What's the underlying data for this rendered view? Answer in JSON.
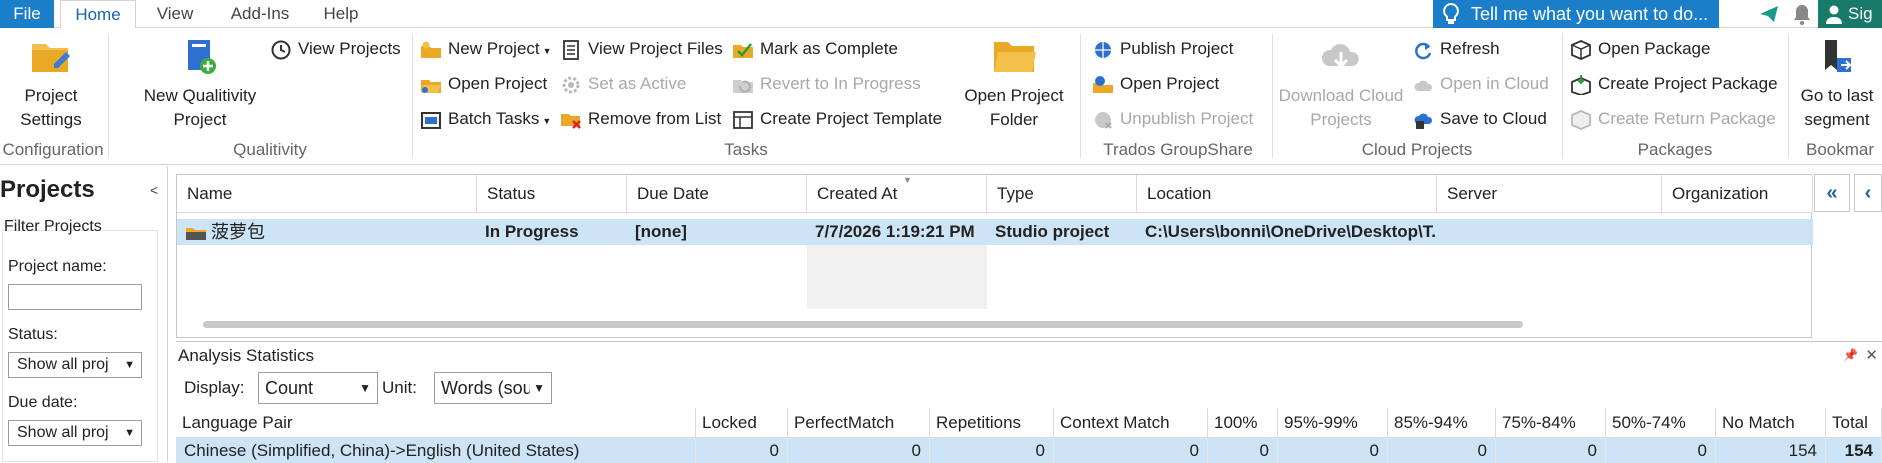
{
  "tabs": {
    "file": "File",
    "home": "Home",
    "view": "View",
    "addins": "Add-Ins",
    "help": "Help"
  },
  "tell_me": "Tell me what you want to do...",
  "sign_in": "Sig",
  "ribbon": {
    "configuration": {
      "project_settings": "Project Settings",
      "group": "Configuration"
    },
    "qualitivity": {
      "new_project": "New Qualitivity Project",
      "view_projects": "View Projects",
      "group": "Qualitivity"
    },
    "tasks": {
      "new_project": "New Project",
      "open_project": "Open Project",
      "batch_tasks": "Batch Tasks",
      "view_project_files": "View Project Files",
      "set_as_active": "Set as Active",
      "remove_from_list": "Remove from List",
      "mark_as_complete": "Mark as Complete",
      "revert_to_in_progress": "Revert to In Progress",
      "create_project_template": "Create Project Template",
      "open_project_folder": "Open Project Folder",
      "group": "Tasks"
    },
    "groupshare": {
      "publish_project": "Publish Project",
      "open_project": "Open Project",
      "unpublish_project": "Unpublish Project",
      "group": "Trados GroupShare"
    },
    "cloud": {
      "download_cloud_projects": "Download Cloud Projects",
      "refresh": "Refresh",
      "open_in_cloud": "Open in Cloud",
      "save_to_cloud": "Save to Cloud",
      "group": "Cloud Projects"
    },
    "packages": {
      "open_package": "Open Package",
      "create_project_package": "Create Project Package",
      "create_return_package": "Create Return Package",
      "group": "Packages"
    },
    "bookmarks": {
      "go_to_last_segment": "Go to last segment",
      "group": "Bookmar"
    }
  },
  "left_panel": {
    "title": "Projects",
    "filter_title": "Filter Projects",
    "project_name_label": "Project name:",
    "project_name_value": "",
    "status_label": "Status:",
    "status_value": "Show all proj",
    "due_date_label": "Due date:",
    "due_date_value": "Show all proj"
  },
  "projects_grid": {
    "columns": [
      "Name",
      "Status",
      "Due Date",
      "Created At",
      "Type",
      "Location",
      "Server",
      "Organization"
    ],
    "rows": [
      {
        "name": "菠萝包",
        "status": "In Progress",
        "due_date": "[none]",
        "created_at": "7/7/2026 1:19:21 PM",
        "type": "Studio project",
        "location": "C:\\Users\\bonni\\OneDrive\\Desktop\\T...",
        "server": "",
        "organization": ""
      }
    ]
  },
  "analysis": {
    "title": "Analysis Statistics",
    "display_label": "Display:",
    "display_value": "Count",
    "unit_label": "Unit:",
    "unit_value": "Words (sou",
    "columns": [
      "Language Pair",
      "Locked",
      "PerfectMatch",
      "Repetitions",
      "Context Match",
      "100%",
      "95%-99%",
      "85%-94%",
      "75%-84%",
      "50%-74%",
      "No Match",
      "Total"
    ],
    "rows": [
      [
        "Chinese (Simplified, China)->English (United States)",
        "0",
        "0",
        "0",
        "0",
        "0",
        "0",
        "0",
        "0",
        "0",
        "154",
        "154"
      ]
    ]
  },
  "colors": {
    "accent": "#1b7ec8",
    "selected_row": "#cce4f5",
    "signin": "#1a7a6a"
  }
}
